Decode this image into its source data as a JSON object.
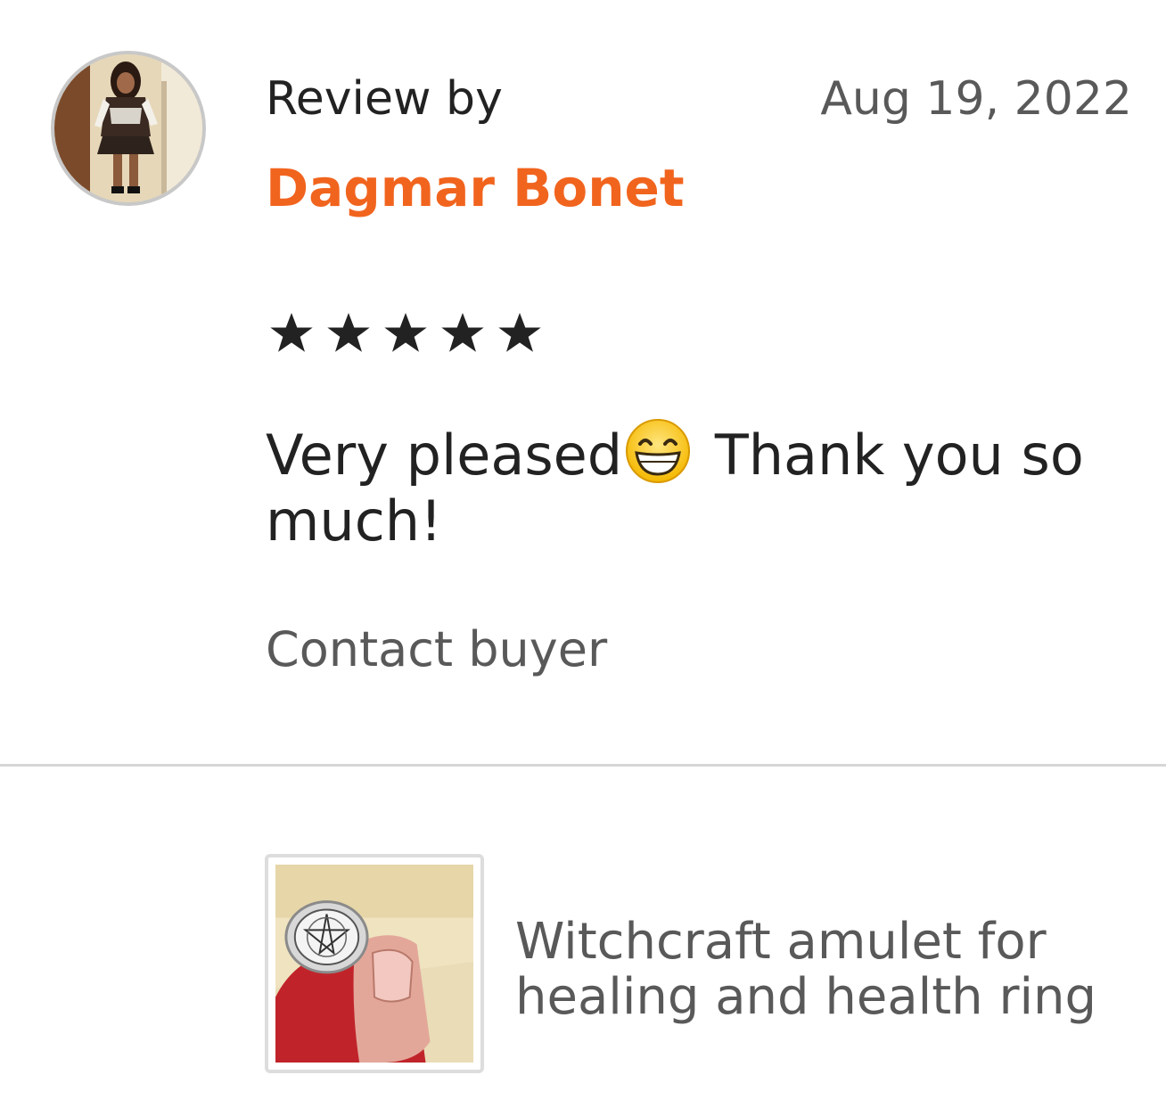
{
  "review": {
    "review_by_label": "Review by",
    "reviewer_name": "Dagmar Bonet",
    "date": "Aug 19, 2022",
    "rating": 5,
    "rating_max": 5,
    "text_before_emoji": "Very pleased",
    "emoji": "grinning-face-with-smiling-eyes",
    "text_after_emoji": " Thank you so much!",
    "contact_label": "Contact buyer"
  },
  "product": {
    "title": "Witchcraft amulet for healing and health ring"
  },
  "colors": {
    "reviewer_name": "#f1641e",
    "primary_text": "#222222",
    "secondary_text": "#595959",
    "divider": "#d6d6d6"
  }
}
